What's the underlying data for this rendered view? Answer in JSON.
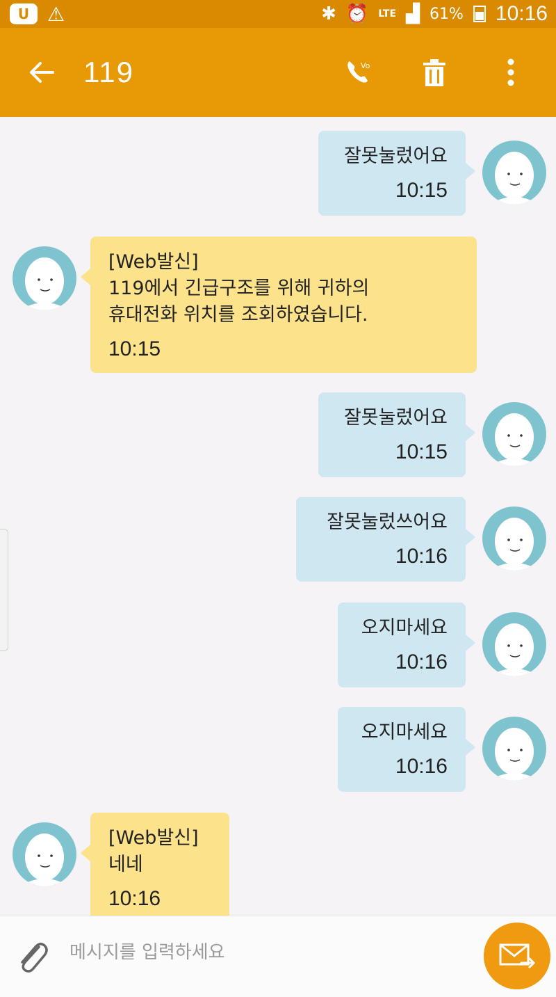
{
  "status_bar": {
    "left_icons": [
      "carrier-u-icon",
      "warning-icon"
    ],
    "right_icons": [
      "bluetooth-icon",
      "alarm-icon",
      "lte-icon",
      "signal-icon",
      "battery-icon"
    ],
    "lte_label": "LTE",
    "battery_pct": "61%",
    "time": "10:16"
  },
  "app_bar": {
    "back_icon": "arrow-left-icon",
    "title": "119",
    "actions": [
      {
        "icon": "video-call-icon"
      },
      {
        "icon": "trash-icon"
      },
      {
        "icon": "more-vert-icon"
      }
    ],
    "colors": {
      "appbar": "#e89a06",
      "statusbar": "#d98a00"
    }
  },
  "messages": [
    {
      "direction": "out",
      "text": "잘못눌렀어요",
      "time": "10:15"
    },
    {
      "direction": "in",
      "text": "[Web발신]\n119에서 긴급구조를 위해 귀하의\n휴대전화 위치를 조회하였습니다.",
      "time": "10:15"
    },
    {
      "direction": "out",
      "text": "잘못눌렀어요",
      "time": "10:15"
    },
    {
      "direction": "out",
      "text": "잘못눌렀쓰어요",
      "time": "10:16"
    },
    {
      "direction": "out",
      "text": "오지마세요",
      "time": "10:16"
    },
    {
      "direction": "out",
      "text": "오지마세요",
      "time": "10:16"
    },
    {
      "direction": "in",
      "text": "[Web발신]\n네네",
      "time": "10:16"
    }
  ],
  "composer": {
    "attach_icon": "paperclip-icon",
    "placeholder": "메시지를 입력하세요",
    "send_icon": "send-message-icon"
  },
  "colors": {
    "bubble_out": "#cfe7f1",
    "bubble_in": "#fde28c",
    "avatar": "#7fc3cf",
    "send_button": "#ef9a10",
    "background": "#f6f3f7"
  }
}
